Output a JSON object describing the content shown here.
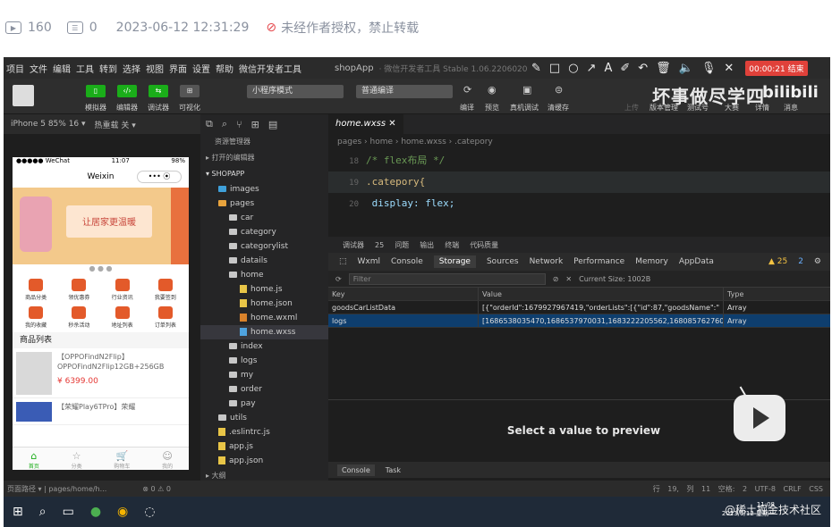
{
  "meta": {
    "views": "160",
    "comments": "0",
    "datetime": "2023-06-12 12:31:29",
    "notice": "未经作者授权，禁止转载"
  },
  "menubar": {
    "items": [
      "项目",
      "文件",
      "编辑",
      "工具",
      "转到",
      "选择",
      "视图",
      "界面",
      "设置",
      "帮助",
      "微信开发者工具"
    ],
    "app_title": "shopApp",
    "app_subtitle": "· 微信开发者工具 Stable 1.06.2206020",
    "recording": "00:00:21 结束"
  },
  "toolbar": {
    "labels": [
      "模拟器",
      "编辑器",
      "调试器",
      "可视化"
    ],
    "mode": "小程序模式",
    "compile": "普通编译",
    "right_labels": [
      "编译",
      "预览",
      "真机调试",
      "清缓存"
    ],
    "far_right": [
      "上传",
      "版本管理",
      "测试号",
      "大赛",
      "详情",
      "消息"
    ],
    "watermark": "坏事做尽学四",
    "brand": "bilibili"
  },
  "simulator": {
    "device": "iPhone 5 85% 16 ▾",
    "reload": "热重载 关 ▾",
    "status_left": "●●●●● WeChat",
    "status_time": "11:07",
    "status_right": "98%",
    "nav_title": "Weixin",
    "banner_text": "让居家更温暖",
    "categories": [
      "商品分类",
      "领优惠券",
      "行业资讯",
      "我要签到",
      "我的收藏",
      "秒杀活动",
      "地址列表",
      "订单列表"
    ],
    "section_title": "商品列表",
    "product1_name": "【OPPOFindN2Flip】",
    "product1_desc": "OPPOFindN2Flip12GB+256GB",
    "product1_price": "¥ 6399.00",
    "product2_name": "【荣耀Play6TPro】荣耀",
    "tabs": [
      "首页",
      "分类",
      "购物车",
      "我的"
    ]
  },
  "explorer": {
    "title": "资源管理器",
    "open_editors": "▸ 打开的编辑器",
    "project": "▾ SHOPAPP",
    "tree": [
      {
        "label": "images",
        "indent": 1,
        "kind": "folder-img"
      },
      {
        "label": "pages",
        "indent": 1,
        "kind": "folder-open"
      },
      {
        "label": "car",
        "indent": 2,
        "kind": "folder"
      },
      {
        "label": "category",
        "indent": 2,
        "kind": "folder"
      },
      {
        "label": "categorylist",
        "indent": 2,
        "kind": "folder"
      },
      {
        "label": "datails",
        "indent": 2,
        "kind": "folder"
      },
      {
        "label": "home",
        "indent": 2,
        "kind": "folder"
      },
      {
        "label": "home.js",
        "indent": 3,
        "kind": "js"
      },
      {
        "label": "home.json",
        "indent": 3,
        "kind": "json"
      },
      {
        "label": "home.wxml",
        "indent": 3,
        "kind": "wxml"
      },
      {
        "label": "home.wxss",
        "indent": 3,
        "kind": "wxss"
      },
      {
        "label": "index",
        "indent": 2,
        "kind": "folder"
      },
      {
        "label": "logs",
        "indent": 2,
        "kind": "folder"
      },
      {
        "label": "my",
        "indent": 2,
        "kind": "folder"
      },
      {
        "label": "order",
        "indent": 2,
        "kind": "folder"
      },
      {
        "label": "pay",
        "indent": 2,
        "kind": "folder"
      },
      {
        "label": "utils",
        "indent": 1,
        "kind": "folder"
      },
      {
        "label": ".eslintrc.js",
        "indent": 1,
        "kind": "js"
      },
      {
        "label": "app.js",
        "indent": 1,
        "kind": "js"
      },
      {
        "label": "app.json",
        "indent": 1,
        "kind": "json"
      }
    ],
    "outline": "▸ 大纲"
  },
  "editor": {
    "tab": "home.wxss",
    "breadcrumb": "pages › home › home.wxss › .catepory",
    "lines": [
      {
        "n": "18",
        "text": "/* flex布局 */",
        "cls": "c-com"
      },
      {
        "n": "19",
        "text": ".catepory{",
        "cls": "c-sel"
      },
      {
        "n": "20",
        "text": "  display: flex;",
        "cls": "c-prop"
      }
    ]
  },
  "devtools": {
    "top_tabs": [
      "调试器",
      "25",
      "问题",
      "输出",
      "终端",
      "代码质量"
    ],
    "tabs": [
      "Wxml",
      "Console",
      "Storage",
      "Sources",
      "Network",
      "Performance",
      "Memory",
      "AppData"
    ],
    "active_tab": "Storage",
    "warnings": "▲ 25",
    "infos": "2",
    "filter_placeholder": "Filter",
    "current_size": "Current Size: 1002B",
    "columns": [
      "Key",
      "Value",
      "Type"
    ],
    "rows": [
      {
        "key": "goodsCarListData",
        "value": "[{\"orderId\":1679927967419,\"orderLists\":[{\"id\":87,\"goodsName\":\"【荣...",
        "type": "Array"
      },
      {
        "key": "logs",
        "value": "[1686538035470,1686537970031,1683222205562,1680857627604,1...",
        "type": "Array"
      }
    ],
    "preview": "Select a value to preview",
    "console_tabs": [
      "Console",
      "Task"
    ]
  },
  "statusbar": {
    "left": "页面路径 ▾ | pages/home/h...",
    "errors": "⊗ 0 ⚠ 0",
    "right": "行 19, 列 11 空格: 2 UTF-8 CRLF CSS"
  },
  "taskbar": {
    "clock": "11:08",
    "date": "2023/6/12 星期一",
    "watermark": "@稀土掘金技术社区"
  }
}
